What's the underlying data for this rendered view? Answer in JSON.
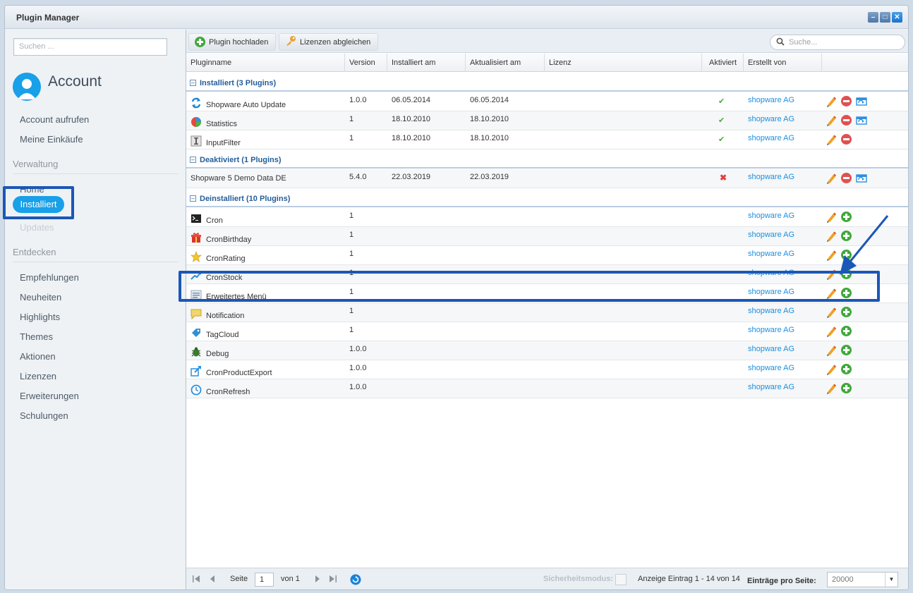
{
  "window": {
    "title": "Plugin Manager"
  },
  "sidebar": {
    "search_placeholder": "Suchen ...",
    "account_title": "Account",
    "account_links": [
      "Account aufrufen",
      "Meine Einkäufe"
    ],
    "verwaltung_title": "Verwaltung",
    "verwaltung_items": [
      "Home",
      "Installiert",
      "Updates"
    ],
    "entdecken_title": "Entdecken",
    "entdecken_items": [
      "Empfehlungen",
      "Neuheiten",
      "Highlights",
      "Themes",
      "Aktionen",
      "Lizenzen",
      "Erweiterungen",
      "Schulungen"
    ]
  },
  "toolbar": {
    "upload_label": "Plugin hochladen",
    "licenses_label": "Lizenzen abgleichen",
    "search_placeholder": "Suche..."
  },
  "columns": [
    "Pluginname",
    "Version",
    "Installiert am",
    "Aktualisiert am",
    "Lizenz",
    "Aktiviert",
    "Erstellt von"
  ],
  "groups": [
    {
      "label": "Installiert (3 Plugins)",
      "rows": [
        {
          "name": "Shopware Auto Update",
          "icon": "refresh-arrows-icon",
          "version": "1.0.0",
          "installed": "06.05.2014",
          "updated": "06.05.2014",
          "active": true,
          "author": "shopware AG",
          "actions": [
            "edit",
            "remove",
            "reinstall"
          ]
        },
        {
          "name": "Statistics",
          "icon": "pie-chart-icon",
          "version": "1",
          "installed": "18.10.2010",
          "updated": "18.10.2010",
          "active": true,
          "author": "shopware AG",
          "actions": [
            "edit",
            "remove",
            "reinstall"
          ]
        },
        {
          "name": "InputFilter",
          "icon": "text-field-icon",
          "version": "1",
          "installed": "18.10.2010",
          "updated": "18.10.2010",
          "active": true,
          "author": "shopware AG",
          "actions": [
            "edit",
            "remove"
          ]
        }
      ]
    },
    {
      "label": "Deaktiviert (1 Plugins)",
      "rows": [
        {
          "name": "Shopware 5 Demo Data DE",
          "icon": "",
          "version": "5.4.0",
          "installed": "22.03.2019",
          "updated": "22.03.2019",
          "active": false,
          "author": "shopware AG",
          "actions": [
            "edit",
            "remove",
            "reinstall"
          ]
        }
      ]
    },
    {
      "label": "Deinstalliert (10 Plugins)",
      "rows": [
        {
          "name": "Cron",
          "icon": "terminal-icon",
          "version": "1",
          "installed": "",
          "updated": "",
          "active": null,
          "author": "shopware AG",
          "actions": [
            "edit",
            "install"
          ]
        },
        {
          "name": "CronBirthday",
          "icon": "gift-icon",
          "version": "1",
          "installed": "",
          "updated": "",
          "active": null,
          "author": "shopware AG",
          "actions": [
            "edit",
            "install"
          ]
        },
        {
          "name": "CronRating",
          "icon": "star-icon",
          "version": "1",
          "installed": "",
          "updated": "",
          "active": null,
          "author": "shopware AG",
          "actions": [
            "edit",
            "install"
          ]
        },
        {
          "name": "CronStock",
          "icon": "trend-chart-icon",
          "version": "1",
          "installed": "",
          "updated": "",
          "active": null,
          "author": "shopware AG",
          "actions": [
            "edit",
            "install"
          ]
        },
        {
          "name": "Erweitertes Menü",
          "icon": "menu-icon",
          "version": "1",
          "installed": "",
          "updated": "",
          "active": null,
          "author": "shopware AG",
          "actions": [
            "edit",
            "install"
          ]
        },
        {
          "name": "Notification",
          "icon": "speech-bubble-icon",
          "version": "1",
          "installed": "",
          "updated": "",
          "active": null,
          "author": "shopware AG",
          "actions": [
            "edit",
            "install"
          ]
        },
        {
          "name": "TagCloud",
          "icon": "tag-icon",
          "version": "1",
          "installed": "",
          "updated": "",
          "active": null,
          "author": "shopware AG",
          "actions": [
            "edit",
            "install"
          ]
        },
        {
          "name": "Debug",
          "icon": "bug-icon",
          "version": "1.0.0",
          "installed": "",
          "updated": "",
          "active": null,
          "author": "shopware AG",
          "actions": [
            "edit",
            "install"
          ]
        },
        {
          "name": "CronProductExport",
          "icon": "export-icon",
          "version": "1.0.0",
          "installed": "",
          "updated": "",
          "active": null,
          "author": "shopware AG",
          "actions": [
            "edit",
            "install"
          ]
        },
        {
          "name": "CronRefresh",
          "icon": "clock-refresh-icon",
          "version": "1.0.0",
          "installed": "",
          "updated": "",
          "active": null,
          "author": "shopware AG",
          "actions": [
            "edit",
            "install"
          ]
        }
      ]
    }
  ],
  "pager": {
    "page_label": "Seite",
    "page_value": "1",
    "of_label": "von 1",
    "safe_mode_label": "Sicherheitsmodus:",
    "display_info": "Anzeige Eintrag 1 - 14 von 14",
    "per_page_label": "Einträge pro Seite:",
    "per_page_value": "20000"
  },
  "colors": {
    "accent": "#18a0e8",
    "highlight": "#1b57b6",
    "link": "#1a8fe0"
  }
}
